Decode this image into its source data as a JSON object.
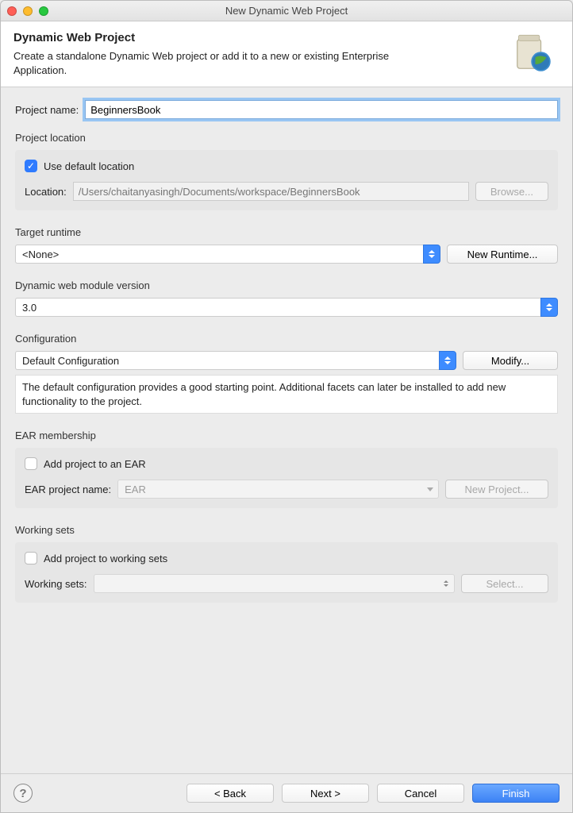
{
  "window": {
    "title": "New Dynamic Web Project"
  },
  "banner": {
    "heading": "Dynamic Web Project",
    "description": "Create a standalone Dynamic Web project or add it to a new or existing Enterprise Application."
  },
  "project_name": {
    "label": "Project name:",
    "value": "BeginnersBook"
  },
  "project_location": {
    "title": "Project location",
    "use_default_label": "Use default location",
    "use_default_checked": true,
    "location_label": "Location:",
    "location_value": "/Users/chaitanyasingh/Documents/workspace/BeginnersBook",
    "browse_label": "Browse..."
  },
  "target_runtime": {
    "title": "Target runtime",
    "value": "<None>",
    "new_runtime_label": "New Runtime..."
  },
  "module_version": {
    "title": "Dynamic web module version",
    "value": "3.0"
  },
  "configuration": {
    "title": "Configuration",
    "value": "Default Configuration",
    "modify_label": "Modify...",
    "description": "The default configuration provides a good starting point. Additional facets can later be installed to add new functionality to the project."
  },
  "ear": {
    "title": "EAR membership",
    "add_label": "Add project to an EAR",
    "add_checked": false,
    "project_name_label": "EAR project name:",
    "project_name_value": "EAR",
    "new_project_label": "New Project..."
  },
  "working_sets": {
    "title": "Working sets",
    "add_label": "Add project to working sets",
    "add_checked": false,
    "label": "Working sets:",
    "value": "",
    "select_label": "Select..."
  },
  "footer": {
    "back": "< Back",
    "next": "Next >",
    "cancel": "Cancel",
    "finish": "Finish"
  }
}
